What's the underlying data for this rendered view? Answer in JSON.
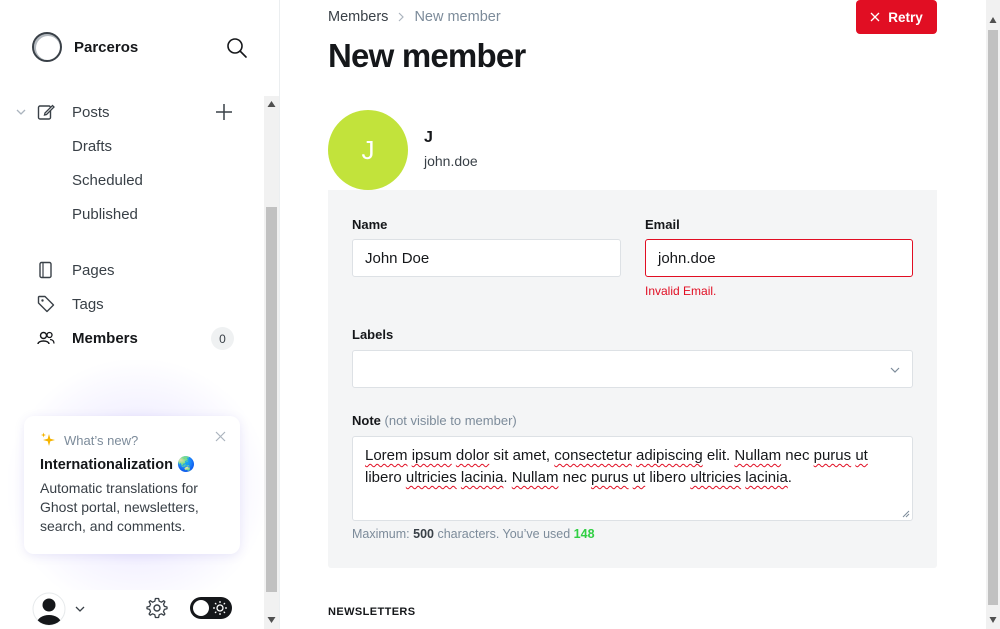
{
  "sidebar": {
    "brand": "Parceros",
    "nav": {
      "posts": "Posts",
      "drafts": "Drafts",
      "scheduled": "Scheduled",
      "published": "Published",
      "pages": "Pages",
      "tags": "Tags",
      "members": "Members",
      "members_count": "0"
    },
    "whats_new": {
      "header": "What’s new?",
      "title": "Internationalization 🌏",
      "body": "Automatic translations for Ghost portal, newsletters, search, and comments."
    }
  },
  "breadcrumb": {
    "parent": "Members",
    "current": "New member"
  },
  "retry_label": "Retry",
  "page_title": "New member",
  "member": {
    "initial": "J",
    "name": "J",
    "email": "john.doe"
  },
  "form": {
    "name_label": "Name",
    "name_value": "John Doe",
    "email_label": "Email",
    "email_value": "john.doe",
    "email_error": "Invalid Email.",
    "labels_label": "Labels",
    "labels_value": "",
    "note_label": "Note",
    "note_hint": "(not visible to member)",
    "note_words": [
      "Lorem",
      " ",
      "ipsum",
      " ",
      "dolor",
      " sit amet, ",
      "consectetur",
      " ",
      "adipiscing",
      " elit. ",
      "Nullam",
      " nec ",
      "purus",
      " ",
      "ut",
      " libero ",
      "ultricies",
      " ",
      "lacinia",
      ". ",
      "Nullam",
      " nec ",
      "purus",
      " ",
      "ut",
      " libero ",
      "ultricies",
      " ",
      "lacinia",
      "."
    ],
    "counter_prefix": "Maximum: ",
    "counter_max": "500",
    "counter_mid": " characters. You’ve used ",
    "counter_used": "148"
  },
  "newsletters_heading": "NEWSLETTERS",
  "colors": {
    "accent_red": "#e10e23",
    "avatar_green": "#c2e33b",
    "used_green": "#30cf43"
  }
}
